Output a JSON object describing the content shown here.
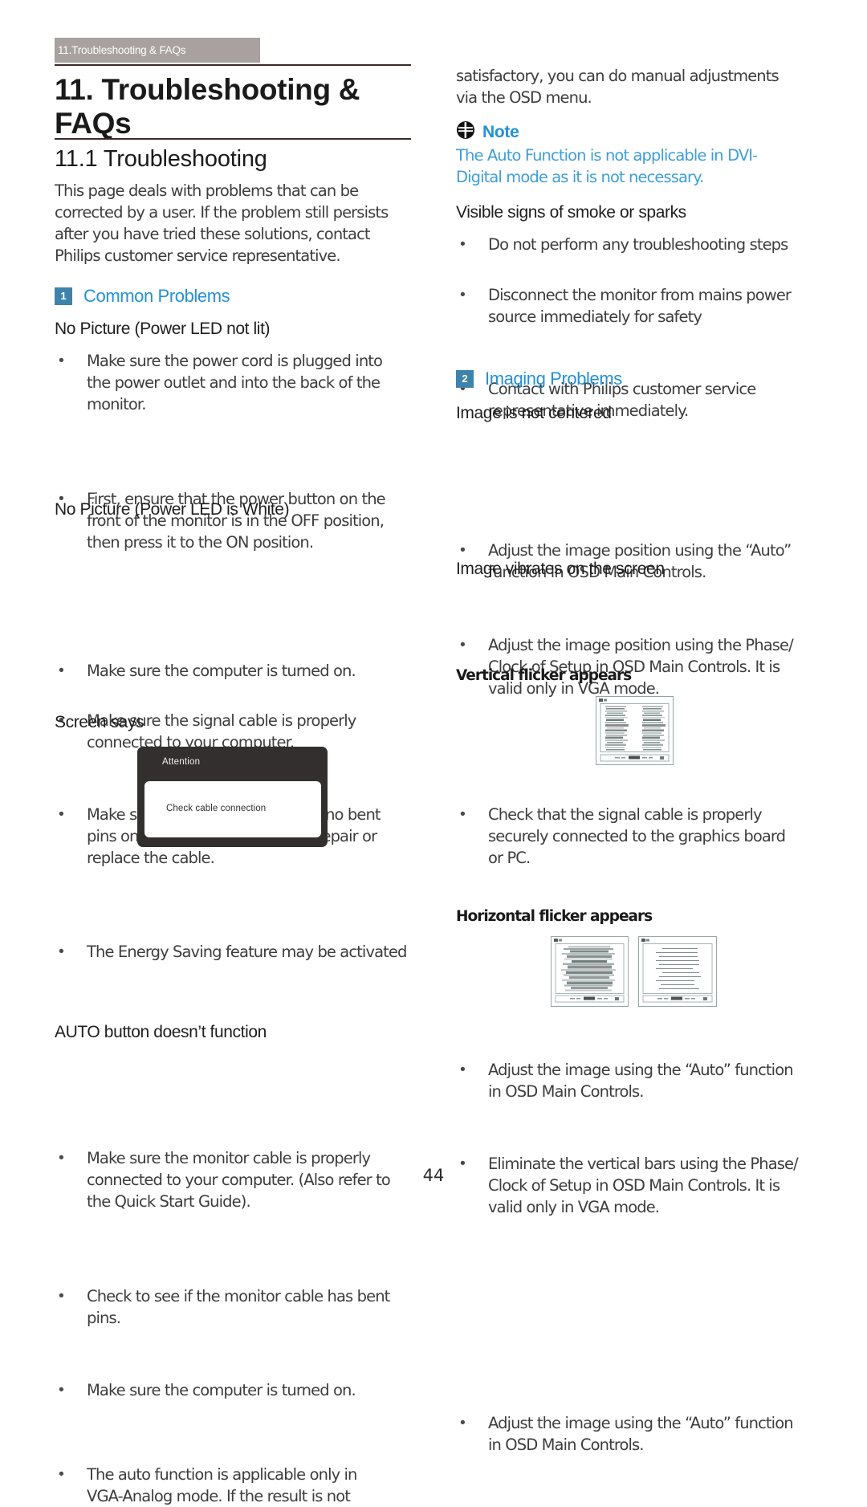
{
  "page": {
    "header_tab": "11.Troubleshooting & FAQs",
    "title": "11. Troubleshooting & FAQs",
    "subtitle": "11.1 Troubleshooting",
    "page_number": "44",
    "colors": {
      "accent_blue": "#2391d5",
      "note_blue": "#3f9ed8",
      "badge_blue": "#3f83ac",
      "tab_gray": "#a8a19f",
      "rule": "#3b2b28",
      "body_text": "#3d3d3d",
      "dialog_bg": "#332f2e"
    }
  },
  "left_column": {
    "intro_lines": [
      "This page deals with problems that can be",
      "corrected by a user. If the problem still persists",
      "after you have tried these solutions, contact",
      "Philips customer service representative."
    ],
    "section_1": {
      "number": "1",
      "title": "Common Problems"
    },
    "h_no_picture_not_lit": "No Picture (Power LED not lit)",
    "bullets_not_lit": [
      {
        "lines": [
          "Make sure the power cord is plugged into",
          "the power outlet and into the back of the",
          "monitor."
        ]
      },
      {
        "lines": [
          "First, ensure that the power button on the",
          "front of the monitor is in the OFF position,",
          "then press it to the ON position."
        ]
      }
    ],
    "h_no_picture_white": "No Picture (Power LED is White)",
    "bullets_white": [
      {
        "lines": [
          "Make sure the computer is turned on."
        ]
      },
      {
        "lines": [
          "Make sure the signal cable is properly",
          "connected to your computer."
        ]
      },
      {
        "lines": [
          "Make sure the monitor cable has no bent",
          "pins on the connect side. If yes, repair or",
          "replace the cable."
        ]
      },
      {
        "lines": [
          "The Energy Saving feature may be activated"
        ]
      }
    ],
    "h_screen_says": "Screen says",
    "osd_dialog": {
      "title": "Attention",
      "message": "Check cable connection"
    },
    "bullets_screen_says": [
      {
        "lines": [
          "Make sure the monitor cable is properly",
          "connected to your computer. (Also refer to",
          "the Quick Start Guide)."
        ]
      },
      {
        "lines": [
          "Check to see if the monitor cable has bent",
          "pins."
        ]
      },
      {
        "lines": [
          "Make sure the computer is turned on."
        ]
      }
    ],
    "h_auto_button": "AUTO button doesn’t function",
    "bullets_auto": [
      {
        "lines": [
          "The auto function is applicable only in",
          "VGA-Analog mode. If the result is not"
        ]
      }
    ]
  },
  "right_column": {
    "continued_lines": [
      "satisfactory, you can do manual adjustments",
      "via the OSD menu."
    ],
    "note": {
      "icon": "note-icon",
      "label": "Note",
      "lines": [
        "The Auto Function is not applicable in DVI-",
        "Digital mode as it is not necessary."
      ]
    },
    "h_smoke": "Visible signs of smoke or sparks",
    "bullets_smoke": [
      {
        "lines": [
          "Do not perform any troubleshooting steps"
        ]
      },
      {
        "lines": [
          "Disconnect the monitor from mains power",
          "source immediately for safety"
        ]
      },
      {
        "lines": [
          "Contact with Philips customer service",
          "representative immediately."
        ]
      }
    ],
    "section_2": {
      "number": "2",
      "title": "Imaging Problems"
    },
    "h_not_centered": "Image is not centered",
    "bullets_not_centered": [
      {
        "lines": [
          "Adjust the image position using the “Auto”",
          "function in OSD Main Controls."
        ]
      },
      {
        "lines": [
          "Adjust the image position using the Phase/",
          "Clock of Setup in OSD Main Controls. It is",
          "valid only in VGA mode."
        ]
      }
    ],
    "h_vibrates": "Image vibrates on the screen",
    "bullets_vibrates": [
      {
        "lines": [
          "Check that the signal cable is properly",
          "securely connected to the graphics board",
          "or PC."
        ]
      }
    ],
    "h_vertical_flicker": "Vertical flicker appears",
    "figure_vertical": "vertical-flicker-screenshot",
    "bullets_vertical": [
      {
        "lines": [
          "Adjust the image using the “Auto” function",
          "in OSD Main Controls."
        ]
      },
      {
        "lines": [
          "Eliminate the vertical bars using the Phase/",
          "Clock of Setup in OSD Main Controls. It is",
          "valid only in VGA mode."
        ]
      }
    ],
    "h_horizontal_flicker": "Horizontal flicker appears",
    "figure_horizontal_before": "horizontal-flicker-screenshot",
    "figure_horizontal_after": "corrected-screen-screenshot",
    "bullets_horizontal": [
      {
        "lines": [
          "Adjust the image using the “Auto” function",
          "in OSD Main Controls."
        ]
      }
    ]
  }
}
